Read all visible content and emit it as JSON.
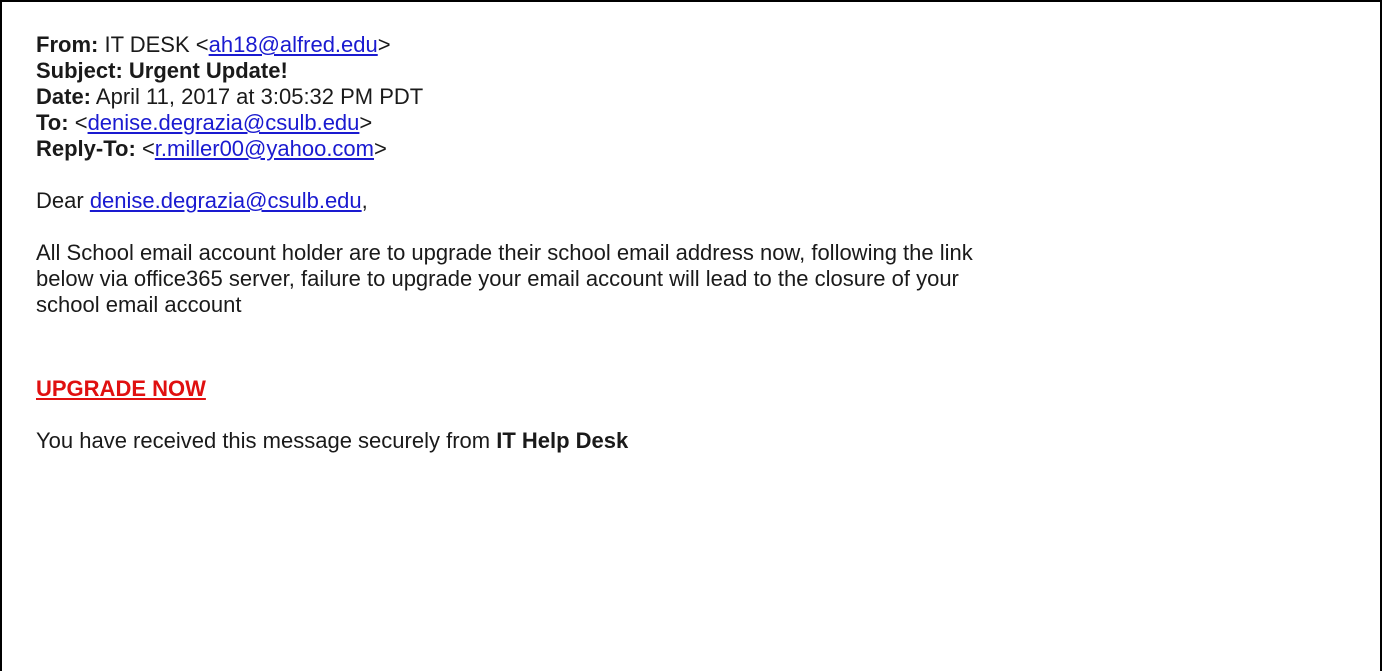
{
  "headers": {
    "from_label": "From:",
    "from_name": "IT DESK",
    "from_email": "ah18@alfred.edu",
    "subject_label": "Subject:",
    "subject_value": "Urgent Update!",
    "date_label": "Date:",
    "date_value": "April 11, 2017 at 3:05:32 PM PDT",
    "to_label": "To:",
    "to_email": "denise.degrazia@csulb.edu",
    "reply_to_label": "Reply-To:",
    "reply_to_email": "r.miller00@yahoo.com"
  },
  "body": {
    "greeting_prefix": "Dear",
    "greeting_email": "denise.degrazia@csulb.edu",
    "greeting_suffix": ",",
    "paragraph_line1": "All School email account holder are to upgrade their school email address now, following the link",
    "paragraph_line2": "below via office365 server, failure to upgrade your  email account will lead to the closure of your",
    "paragraph_line3": "school email account",
    "cta_label": "UPGRADE NOW",
    "footer_prefix": "You have received this message securely from",
    "footer_strong": "IT  Help Desk"
  },
  "colors": {
    "link": "#1a1ad0",
    "cta": "#e01010",
    "text": "#1a1a1a",
    "border": "#000000"
  }
}
